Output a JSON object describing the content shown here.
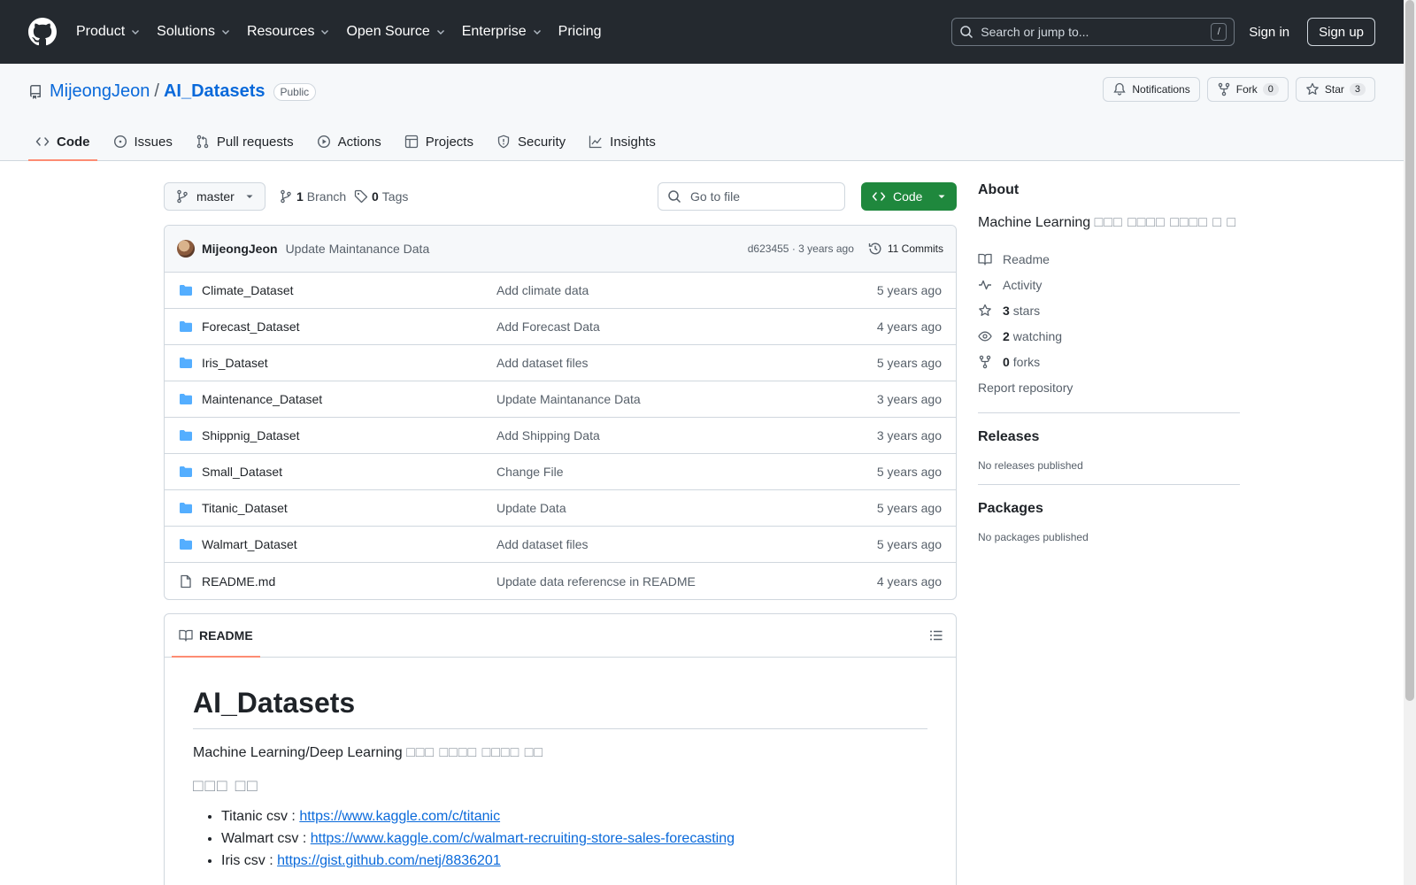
{
  "header": {
    "nav": [
      "Product",
      "Solutions",
      "Resources",
      "Open Source",
      "Enterprise",
      "Pricing"
    ],
    "search_placeholder": "Search or jump to...",
    "search_key": "/",
    "signin": "Sign in",
    "signup": "Sign up"
  },
  "repo": {
    "owner": "MijeongJeon",
    "separator": "/",
    "name": "AI_Datasets",
    "visibility": "Public",
    "notifications": "Notifications",
    "fork_label": "Fork",
    "fork_count": "0",
    "star_label": "Star",
    "star_count": "3"
  },
  "tabs": [
    "Code",
    "Issues",
    "Pull requests",
    "Actions",
    "Projects",
    "Security",
    "Insights"
  ],
  "filenav": {
    "branch": "master",
    "branch_count": "1",
    "branch_label": "Branch",
    "tag_count": "0",
    "tag_label": "Tags",
    "goto_placeholder": "Go to file",
    "code_button": "Code"
  },
  "commit": {
    "author": "MijeongJeon",
    "message": "Update Maintanance Data",
    "hash": "d623455",
    "dot": "·",
    "age": "3 years ago",
    "commits": "11 Commits"
  },
  "files": [
    {
      "name": "Climate_Dataset",
      "type": "dir",
      "message": "Add climate data",
      "age": "5 years ago"
    },
    {
      "name": "Forecast_Dataset",
      "type": "dir",
      "message": "Add Forecast Data",
      "age": "4 years ago"
    },
    {
      "name": "Iris_Dataset",
      "type": "dir",
      "message": "Add dataset files",
      "age": "5 years ago"
    },
    {
      "name": "Maintenance_Dataset",
      "type": "dir",
      "message": "Update Maintanance Data",
      "age": "3 years ago"
    },
    {
      "name": "Shippnig_Dataset",
      "type": "dir",
      "message": "Add Shipping Data",
      "age": "3 years ago"
    },
    {
      "name": "Small_Dataset",
      "type": "dir",
      "message": "Change File",
      "age": "5 years ago"
    },
    {
      "name": "Titanic_Dataset",
      "type": "dir",
      "message": "Update Data",
      "age": "5 years ago"
    },
    {
      "name": "Walmart_Dataset",
      "type": "dir",
      "message": "Add dataset files",
      "age": "5 years ago"
    },
    {
      "name": "README.md",
      "type": "file",
      "message": "Update data referencse in README",
      "age": "4 years ago"
    }
  ],
  "readme": {
    "tab_label": "README",
    "h1": "AI_Datasets",
    "intro": "Machine Learning/Deep Learning",
    "intro_glyphs": "□□□ □□□□ □□□□ □□",
    "h3_glyphs": "□□□ □□",
    "links": [
      {
        "label": "Titanic csv : ",
        "url": "https://www.kaggle.com/c/titanic"
      },
      {
        "label": "Walmart csv : ",
        "url": "https://www.kaggle.com/c/walmart-recruiting-store-sales-forecasting"
      },
      {
        "label": "Iris csv : ",
        "url": "https://gist.github.com/netj/8836201"
      }
    ]
  },
  "sidebar": {
    "about_title": "About",
    "about_text": "Machine Learning",
    "about_glyphs": "□□□ □□□□ □□□□ □ □",
    "readme": "Readme",
    "activity": "Activity",
    "stars_count": "3",
    "stars_label": "stars",
    "watching_count": "2",
    "watching_label": "watching",
    "forks_count": "0",
    "forks_label": "forks",
    "report": "Report repository",
    "releases_title": "Releases",
    "releases_empty": "No releases published",
    "packages_title": "Packages",
    "packages_empty": "No packages published"
  }
}
